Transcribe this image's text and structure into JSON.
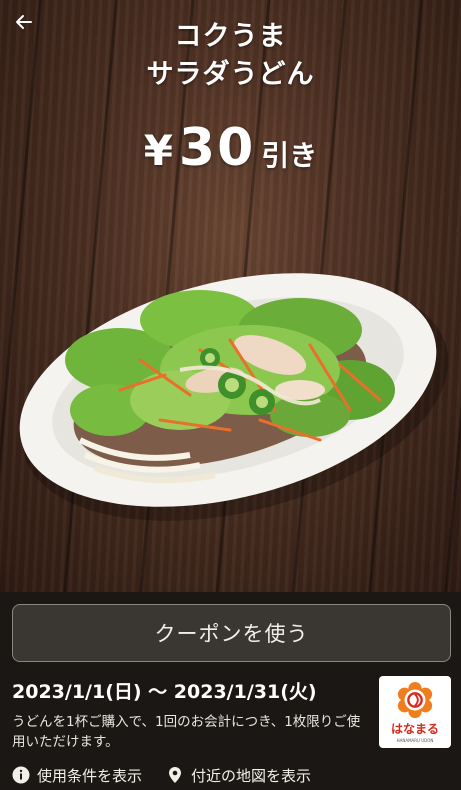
{
  "header": {
    "back_icon": "arrow-left-icon",
    "title_line1": "コクうま",
    "title_line2": "サラダうどん",
    "price_symbol": "¥",
    "price_amount": "30",
    "price_suffix": "引き"
  },
  "coupon": {
    "use_button_label": "クーポンを使う",
    "period": "2023/1/1(日) 〜 2023/1/31(火)",
    "description": "うどんを1杯ご購入で、1回のお会計につき、1枚限りご使用いただけます。",
    "brand_logo_text": "はなまる",
    "brand_logo_sub": "HANAMARU UDON"
  },
  "links": {
    "terms_label": "使用条件を表示",
    "terms_icon": "info-icon",
    "map_label": "付近の地図を表示",
    "map_icon": "location-pin-icon"
  },
  "colors": {
    "brand": "#d9291c",
    "panel_bg": "#1b1714",
    "button_bg": "#3a3632"
  }
}
